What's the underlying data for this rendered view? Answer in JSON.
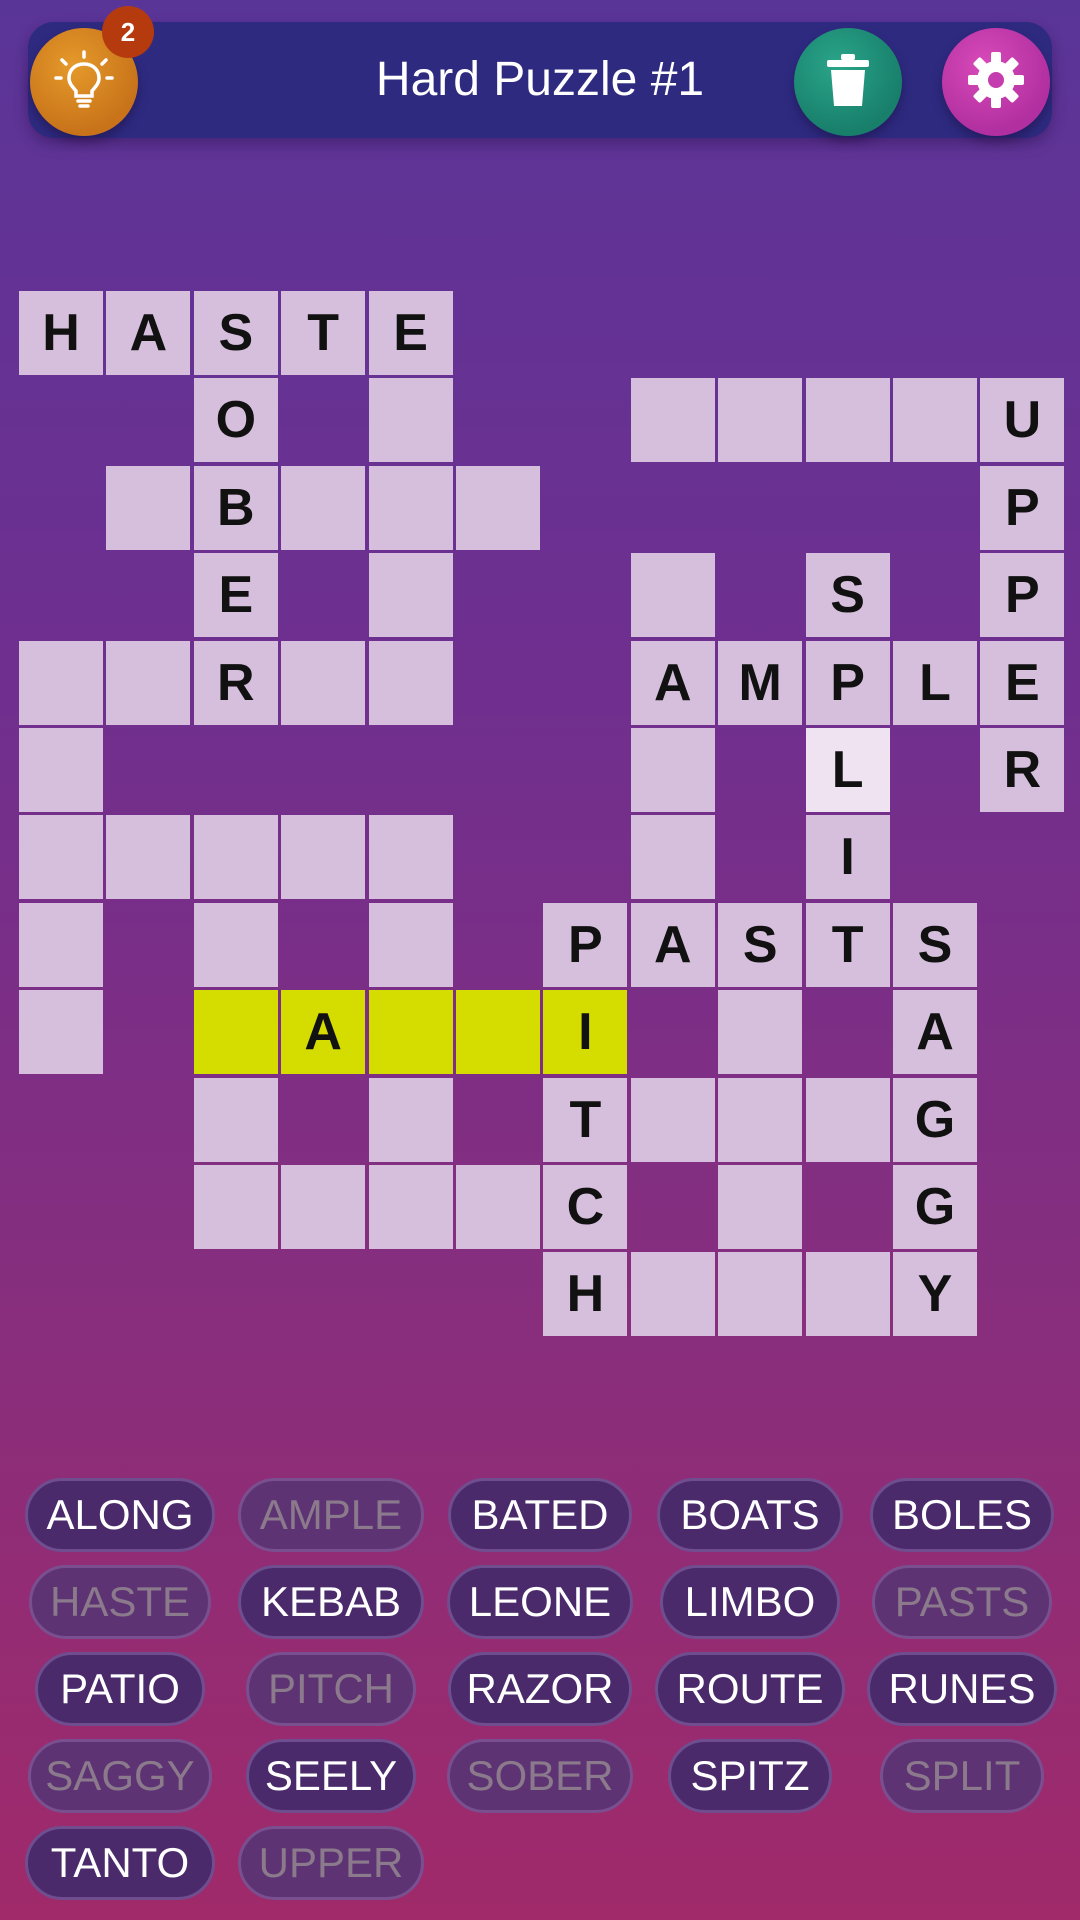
{
  "header": {
    "title": "Hard Puzzle #1",
    "hint_count": "2"
  },
  "colors": {
    "cell": "#d6bfdc",
    "highlight": "#d4dc00",
    "current_cell": "#f0e3f1",
    "hint_button": "#d4861f",
    "trash_button": "#1f9079",
    "settings_button": "#c43cad"
  },
  "icons": {
    "hint": "lightbulb-icon",
    "trash": "trash-icon",
    "settings": "gear-icon"
  },
  "grid": {
    "rows": 12,
    "cols": 12,
    "cells": [
      {
        "r": 0,
        "c": 0,
        "l": "H"
      },
      {
        "r": 0,
        "c": 1,
        "l": "A"
      },
      {
        "r": 0,
        "c": 2,
        "l": "S"
      },
      {
        "r": 0,
        "c": 3,
        "l": "T"
      },
      {
        "r": 0,
        "c": 4,
        "l": "E"
      },
      {
        "r": 1,
        "c": 2,
        "l": "O"
      },
      {
        "r": 1,
        "c": 4,
        "l": ""
      },
      {
        "r": 1,
        "c": 7,
        "l": ""
      },
      {
        "r": 1,
        "c": 8,
        "l": ""
      },
      {
        "r": 1,
        "c": 9,
        "l": ""
      },
      {
        "r": 1,
        "c": 10,
        "l": ""
      },
      {
        "r": 1,
        "c": 11,
        "l": "U"
      },
      {
        "r": 2,
        "c": 1,
        "l": ""
      },
      {
        "r": 2,
        "c": 2,
        "l": "B"
      },
      {
        "r": 2,
        "c": 3,
        "l": ""
      },
      {
        "r": 2,
        "c": 4,
        "l": ""
      },
      {
        "r": 2,
        "c": 5,
        "l": ""
      },
      {
        "r": 2,
        "c": 11,
        "l": "P"
      },
      {
        "r": 3,
        "c": 2,
        "l": "E"
      },
      {
        "r": 3,
        "c": 4,
        "l": ""
      },
      {
        "r": 3,
        "c": 7,
        "l": ""
      },
      {
        "r": 3,
        "c": 9,
        "l": "S"
      },
      {
        "r": 3,
        "c": 11,
        "l": "P"
      },
      {
        "r": 4,
        "c": 0,
        "l": ""
      },
      {
        "r": 4,
        "c": 1,
        "l": ""
      },
      {
        "r": 4,
        "c": 2,
        "l": "R"
      },
      {
        "r": 4,
        "c": 3,
        "l": ""
      },
      {
        "r": 4,
        "c": 4,
        "l": ""
      },
      {
        "r": 4,
        "c": 7,
        "l": "A"
      },
      {
        "r": 4,
        "c": 8,
        "l": "M"
      },
      {
        "r": 4,
        "c": 9,
        "l": "P"
      },
      {
        "r": 4,
        "c": 10,
        "l": "L"
      },
      {
        "r": 4,
        "c": 11,
        "l": "E"
      },
      {
        "r": 5,
        "c": 0,
        "l": ""
      },
      {
        "r": 5,
        "c": 7,
        "l": ""
      },
      {
        "r": 5,
        "c": 9,
        "l": "L",
        "cur": true
      },
      {
        "r": 5,
        "c": 11,
        "l": "R"
      },
      {
        "r": 6,
        "c": 0,
        "l": ""
      },
      {
        "r": 6,
        "c": 1,
        "l": ""
      },
      {
        "r": 6,
        "c": 2,
        "l": ""
      },
      {
        "r": 6,
        "c": 3,
        "l": ""
      },
      {
        "r": 6,
        "c": 4,
        "l": ""
      },
      {
        "r": 6,
        "c": 7,
        "l": ""
      },
      {
        "r": 6,
        "c": 9,
        "l": "I"
      },
      {
        "r": 7,
        "c": 0,
        "l": ""
      },
      {
        "r": 7,
        "c": 2,
        "l": ""
      },
      {
        "r": 7,
        "c": 4,
        "l": ""
      },
      {
        "r": 7,
        "c": 6,
        "l": "P"
      },
      {
        "r": 7,
        "c": 7,
        "l": "A"
      },
      {
        "r": 7,
        "c": 8,
        "l": "S"
      },
      {
        "r": 7,
        "c": 9,
        "l": "T"
      },
      {
        "r": 7,
        "c": 10,
        "l": "S"
      },
      {
        "r": 8,
        "c": 0,
        "l": ""
      },
      {
        "r": 8,
        "c": 2,
        "l": "",
        "hl": true
      },
      {
        "r": 8,
        "c": 3,
        "l": "A",
        "hl": true
      },
      {
        "r": 8,
        "c": 4,
        "l": "",
        "hl": true
      },
      {
        "r": 8,
        "c": 5,
        "l": "",
        "hl": true
      },
      {
        "r": 8,
        "c": 6,
        "l": "I",
        "hl": true
      },
      {
        "r": 8,
        "c": 8,
        "l": ""
      },
      {
        "r": 8,
        "c": 10,
        "l": "A"
      },
      {
        "r": 9,
        "c": 2,
        "l": ""
      },
      {
        "r": 9,
        "c": 4,
        "l": ""
      },
      {
        "r": 9,
        "c": 6,
        "l": "T"
      },
      {
        "r": 9,
        "c": 7,
        "l": ""
      },
      {
        "r": 9,
        "c": 8,
        "l": ""
      },
      {
        "r": 9,
        "c": 9,
        "l": ""
      },
      {
        "r": 9,
        "c": 10,
        "l": "G"
      },
      {
        "r": 10,
        "c": 2,
        "l": ""
      },
      {
        "r": 10,
        "c": 3,
        "l": ""
      },
      {
        "r": 10,
        "c": 4,
        "l": ""
      },
      {
        "r": 10,
        "c": 5,
        "l": ""
      },
      {
        "r": 10,
        "c": 6,
        "l": "C"
      },
      {
        "r": 10,
        "c": 8,
        "l": ""
      },
      {
        "r": 10,
        "c": 10,
        "l": "G"
      },
      {
        "r": 11,
        "c": 6,
        "l": "H"
      },
      {
        "r": 11,
        "c": 7,
        "l": ""
      },
      {
        "r": 11,
        "c": 8,
        "l": ""
      },
      {
        "r": 11,
        "c": 9,
        "l": ""
      },
      {
        "r": 11,
        "c": 10,
        "l": "Y"
      }
    ]
  },
  "words": [
    {
      "text": "ALONG",
      "used": false
    },
    {
      "text": "AMPLE",
      "used": true
    },
    {
      "text": "BATED",
      "used": false
    },
    {
      "text": "BOATS",
      "used": false
    },
    {
      "text": "BOLES",
      "used": false
    },
    {
      "text": "HASTE",
      "used": true
    },
    {
      "text": "KEBAB",
      "used": false
    },
    {
      "text": "LEONE",
      "used": false
    },
    {
      "text": "LIMBO",
      "used": false
    },
    {
      "text": "PASTS",
      "used": true
    },
    {
      "text": "PATIO",
      "used": false
    },
    {
      "text": "PITCH",
      "used": true
    },
    {
      "text": "RAZOR",
      "used": false
    },
    {
      "text": "ROUTE",
      "used": false
    },
    {
      "text": "RUNES",
      "used": false
    },
    {
      "text": "SAGGY",
      "used": true
    },
    {
      "text": "SEELY",
      "used": false
    },
    {
      "text": "SOBER",
      "used": true
    },
    {
      "text": "SPITZ",
      "used": false
    },
    {
      "text": "SPLIT",
      "used": true
    },
    {
      "text": "TANTO",
      "used": false
    },
    {
      "text": "UPPER",
      "used": true
    }
  ]
}
